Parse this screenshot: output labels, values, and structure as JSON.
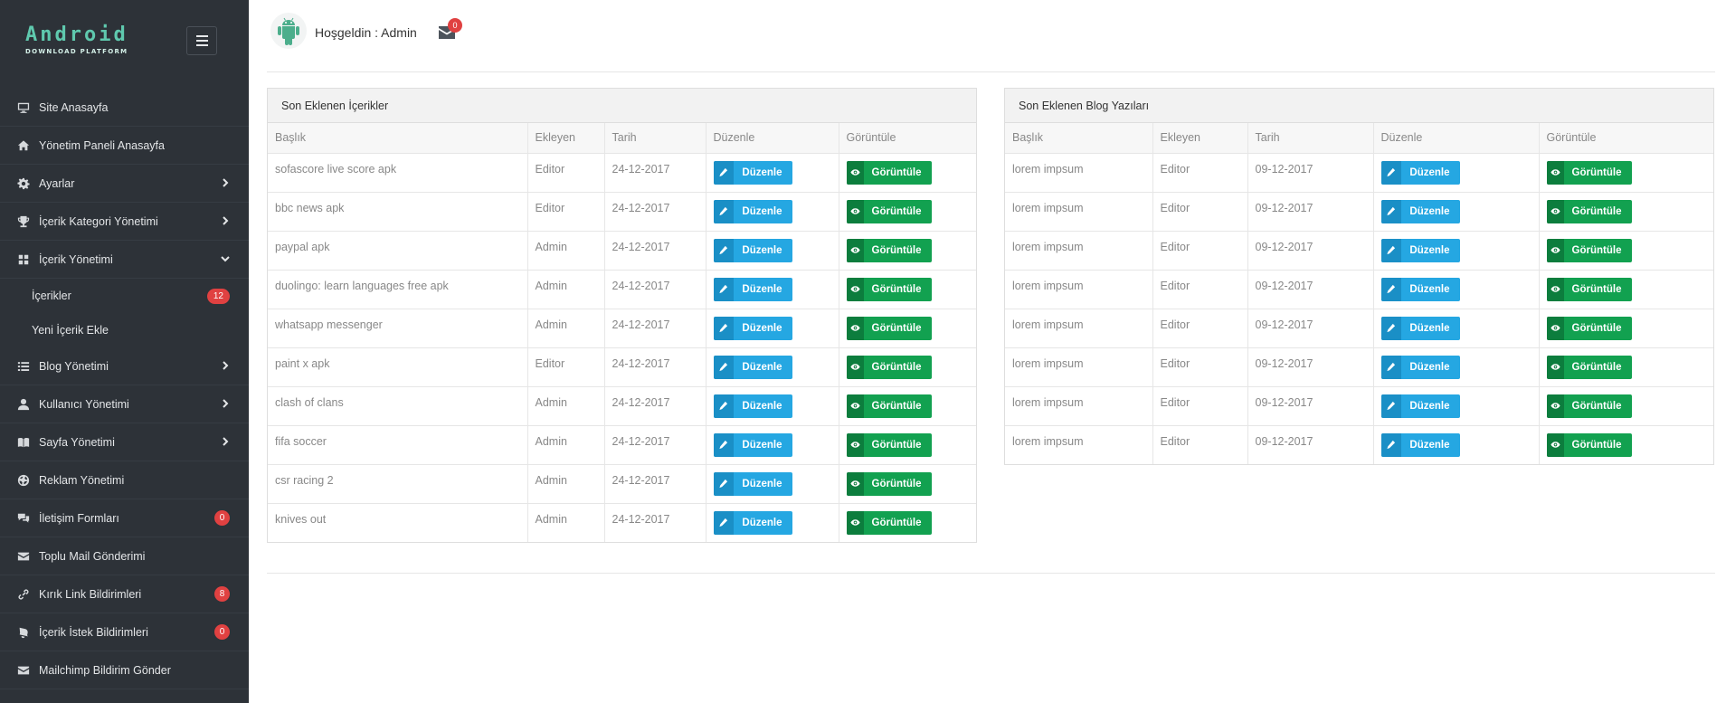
{
  "brand": {
    "line1": "Android",
    "line2": "DOWNLOAD PLATFORM"
  },
  "sidebar": {
    "items": [
      {
        "label": "Site Anasayfa",
        "icon": "monitor-icon"
      },
      {
        "label": "Yönetim Paneli Anasayfa",
        "icon": "home-icon"
      },
      {
        "label": "Ayarlar",
        "icon": "gear-icon",
        "chevron": "right"
      },
      {
        "label": "İçerik Kategori Yönetimi",
        "icon": "trophy-icon",
        "chevron": "right"
      },
      {
        "label": "İçerik Yönetimi",
        "icon": "grid-icon",
        "chevron": "down"
      },
      {
        "label": "İçerikler",
        "sub": true,
        "badge": "12"
      },
      {
        "label": "Yeni İçerik Ekle",
        "sub": true
      },
      {
        "label": "Blog Yönetimi",
        "icon": "list-icon",
        "chevron": "right"
      },
      {
        "label": "Kullanıcı Yönetimi",
        "icon": "user-icon",
        "chevron": "right"
      },
      {
        "label": "Sayfa Yönetimi",
        "icon": "book-icon",
        "chevron": "right"
      },
      {
        "label": "Reklam Yönetimi",
        "icon": "globe-icon"
      },
      {
        "label": "İletişim Formları",
        "icon": "chat-icon",
        "badge": "0"
      },
      {
        "label": "Toplu Mail Gönderimi",
        "icon": "envelope-icon"
      },
      {
        "label": "Kırık Link Bildirimleri",
        "icon": "link-icon",
        "badge": "8"
      },
      {
        "label": "İçerik İstek Bildirimleri",
        "icon": "bell-icon",
        "badge": "0"
      },
      {
        "label": "Mailchimp Bildirim Gönder",
        "icon": "envelope-icon"
      }
    ]
  },
  "header": {
    "welcome": "Hoşgeldin : Admin",
    "mail_count": "0"
  },
  "columns": [
    "Başlık",
    "Ekleyen",
    "Tarih",
    "Düzenle",
    "Görüntüle"
  ],
  "buttons": {
    "edit": "Düzenle",
    "view": "Görüntüle"
  },
  "content_panel": {
    "title": "Son Eklenen İçerikler",
    "rows": [
      {
        "title": "sofascore live score apk",
        "author": "Editor",
        "date": "24-12-2017"
      },
      {
        "title": "bbc news apk",
        "author": "Editor",
        "date": "24-12-2017"
      },
      {
        "title": "paypal apk",
        "author": "Admin",
        "date": "24-12-2017"
      },
      {
        "title": "duolingo: learn languages free apk",
        "author": "Admin",
        "date": "24-12-2017"
      },
      {
        "title": "whatsapp messenger",
        "author": "Admin",
        "date": "24-12-2017"
      },
      {
        "title": "paint x apk",
        "author": "Editor",
        "date": "24-12-2017"
      },
      {
        "title": "clash of clans",
        "author": "Admin",
        "date": "24-12-2017"
      },
      {
        "title": "fifa soccer",
        "author": "Admin",
        "date": "24-12-2017"
      },
      {
        "title": "csr racing 2",
        "author": "Admin",
        "date": "24-12-2017"
      },
      {
        "title": "knives out",
        "author": "Admin",
        "date": "24-12-2017"
      }
    ]
  },
  "blog_panel": {
    "title": "Son Eklenen Blog Yazıları",
    "rows": [
      {
        "title": "lorem impsum",
        "author": "Editor",
        "date": "09-12-2017"
      },
      {
        "title": "lorem impsum",
        "author": "Editor",
        "date": "09-12-2017"
      },
      {
        "title": "lorem impsum",
        "author": "Editor",
        "date": "09-12-2017"
      },
      {
        "title": "lorem impsum",
        "author": "Editor",
        "date": "09-12-2017"
      },
      {
        "title": "lorem impsum",
        "author": "Editor",
        "date": "09-12-2017"
      },
      {
        "title": "lorem impsum",
        "author": "Editor",
        "date": "09-12-2017"
      },
      {
        "title": "lorem impsum",
        "author": "Editor",
        "date": "09-12-2017"
      },
      {
        "title": "lorem impsum",
        "author": "Editor",
        "date": "09-12-2017"
      }
    ]
  },
  "colors": {
    "sidebar_bg": "#2d3238",
    "brand": "#5fc9ae",
    "edit_button": "#25a7e2",
    "view_button": "#12a150",
    "badge": "#e04141"
  }
}
